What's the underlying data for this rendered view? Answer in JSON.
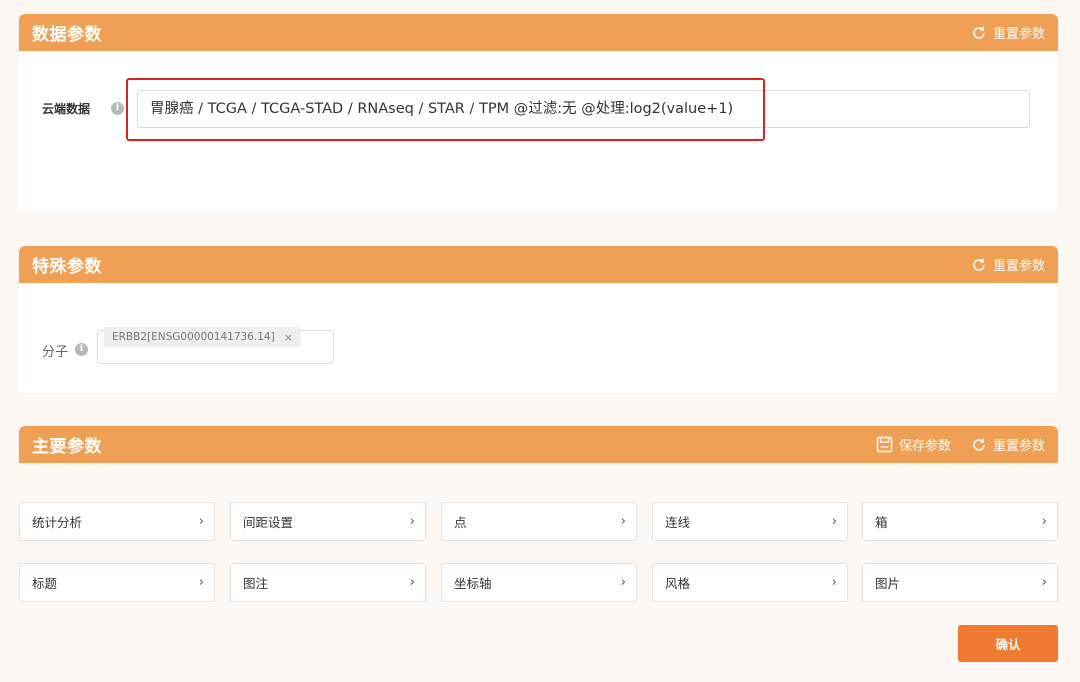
{
  "data_panel": {
    "title": "数据参数",
    "reset_label": "重置参数",
    "cloud_label": "云端数据",
    "cloud_value": "胃腺癌 / TCGA / TCGA-STAD / RNAseq / STAR / TPM @过滤:无 @处理:log2(value+1)"
  },
  "special_panel": {
    "title": "特殊参数",
    "reset_label": "重置参数",
    "molecule_label": "分子",
    "molecule_tag": "ERBB2[ENSG00000141736.14]"
  },
  "main_panel": {
    "title": "主要参数",
    "save_label": "保存参数",
    "reset_label": "重置参数",
    "rows": [
      [
        "统计分析",
        "间距设置",
        "点",
        "连线",
        "箱"
      ],
      [
        "标题",
        "图注",
        "坐标轴",
        "风格",
        "图片"
      ]
    ]
  },
  "confirm_label": "确认",
  "colors": {
    "header": "#f0a055",
    "confirm": "#f07a30",
    "highlight": "#e02020"
  }
}
